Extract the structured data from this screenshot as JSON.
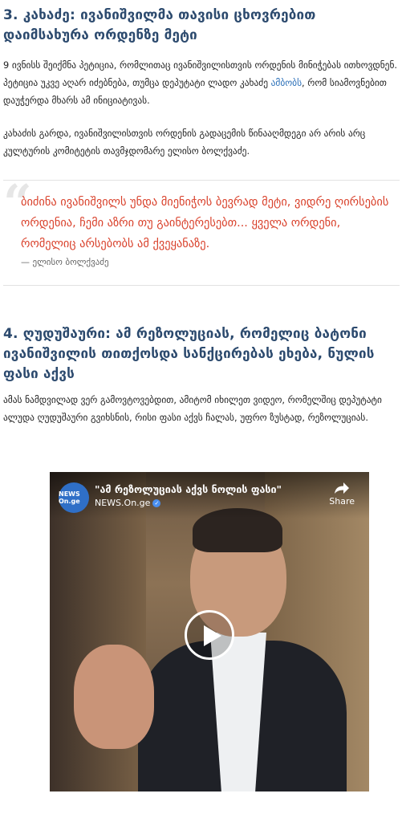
{
  "section3": {
    "heading": "3. კახაძე: ივანიშვილმა თავისი ცხოვრებით დაიმსახურა ორდენზე მეტი",
    "para1_before_link": "9 ივნისს შეიქმნა პეტიცია, რომლითაც ივანიშვილისთვის ორდენის მინიჭებას ითხოვდნენ. პეტიცია უკვე აღარ იძებნება, თუმცა დეპუტატი ლადო კახაძე ",
    "para1_link": "ამბობს",
    "para1_after_link": ", რომ სიამოვნებით დაუჭერდა მხარს ამ ინიციატივას.",
    "para2": "კახაძის გარდა, ივანიშვილისთვის ორდენის გადაცემის წინააღმდეგი არ არის არც კულტურის კომიტეტის თავმჯდომარე ელისო ბოლქვაძე."
  },
  "quote": {
    "mark": "“",
    "text": "ბიძინა ივანიშვილს უნდა მიენიჭოს ბევრად მეტი, ვიდრე ღირსების ორდენია, ჩემი აზრი თუ გაინტერესებთ... ყველა ორდენი, რომელიც არსებობს ამ ქვეყანაზე.",
    "author": "— ელისო ბოლქვაძე"
  },
  "section4": {
    "heading": "4. ღუდუშაური: ამ რეზოლუციას, რომელიც ბატონი ივანიშვილის თითქოსდა სანქცირებას ეხება, ნულის ფასი აქვს",
    "para": "ამას ნამდვილად ვერ გამოვტოვებდით, ამიტომ იხილეთ ვიდეო, რომელშიც დეპუტატი ალუდა ღუდუშაური გვიხსნის, რისი ფასი აქვს ჩალას, უფრო ზუსტად, რეზოლუციას."
  },
  "video": {
    "title": "\"ამ რეზოლუციას აქვს ნოლის ფასი\"",
    "channel": "NEWS.On.ge",
    "logo_text": "NEWS On.ge",
    "share_label": "Share",
    "verified_glyph": "✓"
  }
}
